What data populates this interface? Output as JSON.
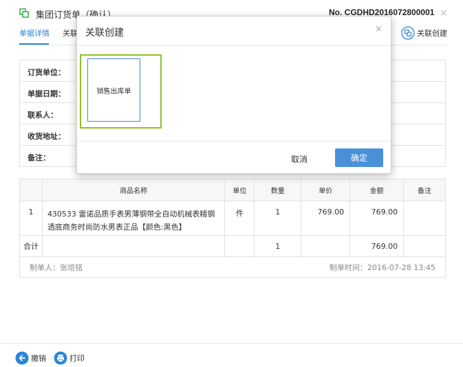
{
  "header": {
    "title": "集团订货单（确认）",
    "order_no": "No. CGDHD2016072800001",
    "close_glyph": "×"
  },
  "tabs": [
    {
      "label": "单据详情"
    },
    {
      "label": "关联"
    }
  ],
  "actions": {
    "associate_create": "关联创建"
  },
  "info": {
    "fields": [
      {
        "label": "订货单位："
      },
      {
        "label": "单据日期："
      },
      {
        "label": "联系人："
      },
      {
        "label": "收货地址："
      },
      {
        "label": "备注："
      }
    ]
  },
  "goods": {
    "headers": {
      "name": "商品名称",
      "unit": "单位",
      "qty": "数量",
      "price": "单价",
      "amount": "金额",
      "note": "备注"
    },
    "rows": [
      {
        "idx": "1",
        "name": "430533 雷诺品质手表男薄钢带全自动机械表精钢透底商务时尚防水男表正品【颜色:黑色】",
        "unit": "件",
        "qty": "1",
        "price": "769.00",
        "amount": "769.00",
        "note": ""
      }
    ],
    "total": {
      "label": "合计",
      "qty": "1",
      "amount": "769.00"
    },
    "footer": {
      "maker": "制单人：张培铭",
      "time": "制单时间：2016-07-28 13:45"
    }
  },
  "bottom": {
    "undo": "撤销",
    "print": "打印"
  },
  "modal": {
    "title": "关联创建",
    "close_glyph": "×",
    "option": "销售出库单",
    "cancel": "取消",
    "confirm": "确定"
  },
  "colors": {
    "accent": "#2b85d6",
    "confirm_button": "#4a90d9",
    "selected_frame": "#8dc21f",
    "header_icon": "#3bb54a"
  },
  "icons": {
    "header": "document-copy-icon",
    "associate": "link-create-icon",
    "undo": "undo-arrow-icon",
    "print": "printer-icon"
  }
}
